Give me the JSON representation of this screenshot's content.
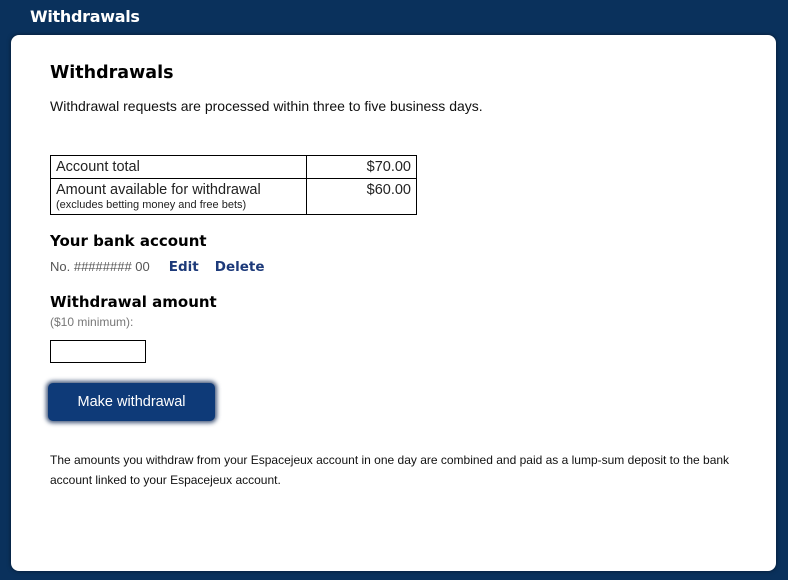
{
  "header": {
    "title": "Withdrawals"
  },
  "main": {
    "title": "Withdrawals",
    "intro": "Withdrawal requests are processed within three to five business days.",
    "balances": [
      {
        "label": "Account total",
        "note": "",
        "value": "$70.00"
      },
      {
        "label": "Amount available for withdrawal",
        "note": "(excludes betting money and free bets)",
        "value": "$60.00"
      }
    ],
    "bank": {
      "heading": "Your bank account",
      "account_number": "No. ######## 00",
      "edit_label": "Edit",
      "delete_label": "Delete"
    },
    "withdrawal": {
      "heading": "Withdrawal amount",
      "minimum_note": "($10 minimum):",
      "amount_value": "",
      "button_label": "Make withdrawal"
    },
    "footer_text": "The amounts you withdraw from your Espacejeux account in one day are combined and paid as a lump-sum deposit to the bank account linked to your Espacejeux account."
  },
  "colors": {
    "header_background": "#0a315c",
    "link": "#1d3a7a",
    "button_background": "#0e3a78"
  }
}
